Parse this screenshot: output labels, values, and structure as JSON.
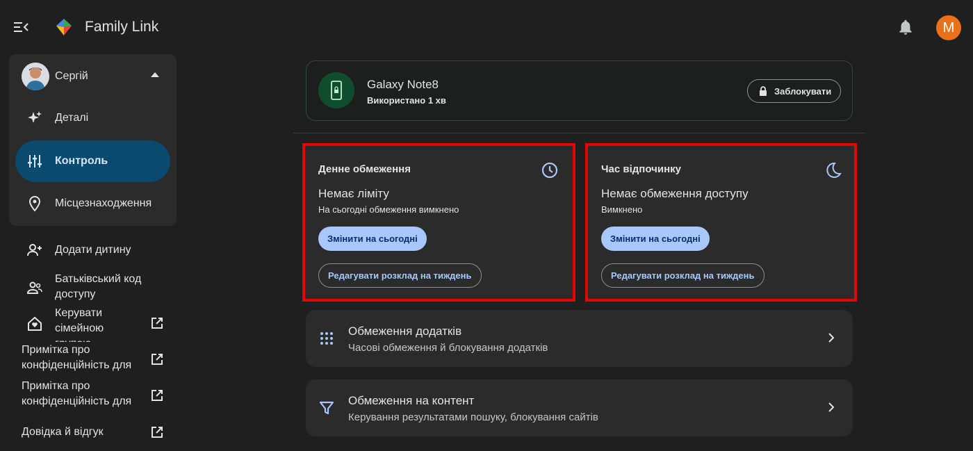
{
  "app": {
    "title": "Family Link",
    "avatar_letter": "M"
  },
  "sidebar": {
    "child_name": "Сергій",
    "nav": [
      {
        "label": "Деталі"
      },
      {
        "label": "Контроль"
      },
      {
        "label": "Місцезнаходження"
      }
    ],
    "links": [
      {
        "label": "Додати дитину"
      },
      {
        "label": "Батьківський код доступу"
      },
      {
        "label": "Керувати сімейною групою"
      },
      {
        "label": "Примітка про конфіденційність для батьків"
      },
      {
        "label": "Примітка про конфіденційність для дітей"
      },
      {
        "label": "Довідка й відгук"
      }
    ]
  },
  "device": {
    "name": "Galaxy Note8",
    "used": "Використано 1 хв",
    "lock_label": "Заблокувати"
  },
  "daily_limit": {
    "title": "Денне обмеження",
    "status": "Немає ліміту",
    "sub": "На сьогодні обмеження вимкнено",
    "change_label": "Змінити на сьогодні",
    "edit_label": "Редагувати розклад на тиждень"
  },
  "downtime": {
    "title": "Час відпочинку",
    "status": "Немає обмеження доступу",
    "sub": "Вимкнено",
    "change_label": "Змінити на сьогодні",
    "edit_label": "Редагувати розклад на тиждень"
  },
  "rows": [
    {
      "title": "Обмеження додатків",
      "sub": "Часові обмеження й блокування додатків"
    },
    {
      "title": "Обмеження на контент",
      "sub": "Керування результатами пошуку, блокування сайтів"
    }
  ],
  "colors": {
    "accent": "#a8c7fa",
    "highlight_border": "#e10600",
    "nav_active": "#0b4a6f",
    "avatar": "#e8711a"
  }
}
